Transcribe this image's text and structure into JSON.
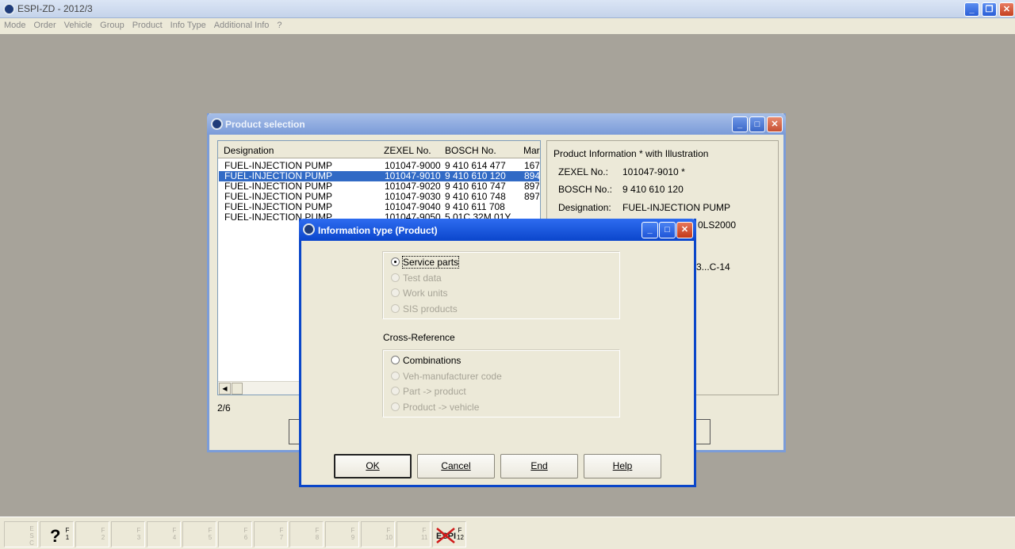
{
  "app": {
    "title": "ESPI-ZD  - 2012/3"
  },
  "menu": [
    "Mode",
    "Order",
    "Vehicle",
    "Group",
    "Product",
    "Info Type",
    "Additional Info",
    "?"
  ],
  "product_window": {
    "title": "Product selection",
    "columns": [
      "Designation",
      "ZEXEL No.",
      "BOSCH No.",
      "Mar"
    ],
    "rows": [
      {
        "designation": "FUEL-INJECTION PUMP",
        "zexel": "101047-9000",
        "bosch": "9 410 614 477",
        "mar": "167"
      },
      {
        "designation": "FUEL-INJECTION PUMP",
        "zexel": "101047-9010",
        "bosch": "9 410 610 120",
        "mar": "894"
      },
      {
        "designation": "FUEL-INJECTION PUMP",
        "zexel": "101047-9020",
        "bosch": "9 410 610 747",
        "mar": "897"
      },
      {
        "designation": "FUEL-INJECTION PUMP",
        "zexel": "101047-9030",
        "bosch": "9 410 610 748",
        "mar": "897"
      },
      {
        "designation": "FUEL-INJECTION PUMP",
        "zexel": "101047-9040",
        "bosch": "9 410 611 708",
        "mar": ""
      },
      {
        "designation": "FUEL-INJECTION PUMP",
        "zexel": "101047-9050",
        "bosch": "5 01C 32M 01Y",
        "mar": ""
      }
    ],
    "selected_index": 1,
    "counter": "2/6",
    "info": {
      "heading": "Product Information * with Illustration",
      "zexel_label": "ZEXEL No.:",
      "zexel_value": "101047-9010  *",
      "bosch_label": "BOSCH No.:",
      "bosch_value": "9 410 610 120",
      "designation_label": "Designation:",
      "designation_value": "FUEL-INJECTION PUMP",
      "partial_1": "0LS2000",
      "partial_2": "3...C-14"
    }
  },
  "dialog": {
    "title": "Information type (Product)",
    "options": [
      {
        "label": "Service parts",
        "enabled": true,
        "checked": true
      },
      {
        "label": "Test data",
        "enabled": false,
        "checked": false
      },
      {
        "label": "Work units",
        "enabled": false,
        "checked": false
      },
      {
        "label": "SIS products",
        "enabled": false,
        "checked": false
      }
    ],
    "cross_reference_label": "Cross-Reference",
    "cross_options": [
      {
        "label": "Combinations",
        "enabled": true,
        "checked": false
      },
      {
        "label": "Veh-manufacturer code",
        "enabled": false,
        "checked": false
      },
      {
        "label": "Part -> product",
        "enabled": false,
        "checked": false
      },
      {
        "label": "Product -> vehicle",
        "enabled": false,
        "checked": false
      }
    ],
    "buttons": {
      "ok": "OK",
      "cancel": "Cancel",
      "end": "End",
      "help": "Help"
    }
  },
  "fkeys": {
    "esc": "ESC",
    "f1_glyph": "?",
    "labels": [
      "F1",
      "F2",
      "F3",
      "F4",
      "F5",
      "F6",
      "F7",
      "F8",
      "F9",
      "F10",
      "F11",
      "F12"
    ],
    "espi": "ESPI"
  }
}
